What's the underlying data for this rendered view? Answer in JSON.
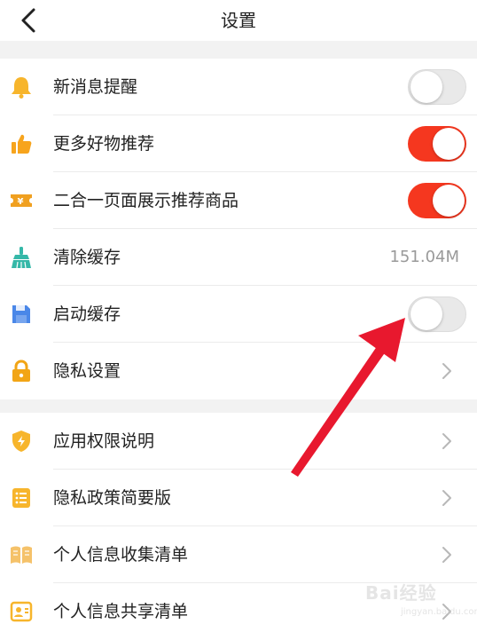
{
  "header": {
    "title": "设置",
    "back_icon": "chevron-left-icon"
  },
  "section1": [
    {
      "label": "新消息提醒",
      "icon": "bell-icon",
      "control": "toggle",
      "on": false
    },
    {
      "label": "更多好物推荐",
      "icon": "thumbs-up-icon",
      "control": "toggle",
      "on": true
    },
    {
      "label": "二合一页面展示推荐商品",
      "icon": "ticket-icon",
      "control": "toggle",
      "on": true
    },
    {
      "label": "清除缓存",
      "icon": "broom-icon",
      "control": "value",
      "value": "151.04M"
    },
    {
      "label": "启动缓存",
      "icon": "floppy-disk-icon",
      "control": "toggle",
      "on": false
    },
    {
      "label": "隐私设置",
      "icon": "lock-icon",
      "control": "chevron"
    }
  ],
  "section2": [
    {
      "label": "应用权限说明",
      "icon": "shield-icon",
      "control": "chevron"
    },
    {
      "label": "隐私政策简要版",
      "icon": "list-document-icon",
      "control": "chevron"
    },
    {
      "label": "个人信息收集清单",
      "icon": "open-book-icon",
      "control": "chevron"
    },
    {
      "label": "个人信息共享清单",
      "icon": "profile-card-icon",
      "control": "chevron"
    }
  ],
  "watermark": {
    "text": "Bai经验",
    "sub": "jingyan.baidu.com"
  },
  "colors": {
    "toggle_on": "#f5371f",
    "toggle_off": "#e9e9e9",
    "annotation_arrow": "#e8182e"
  }
}
